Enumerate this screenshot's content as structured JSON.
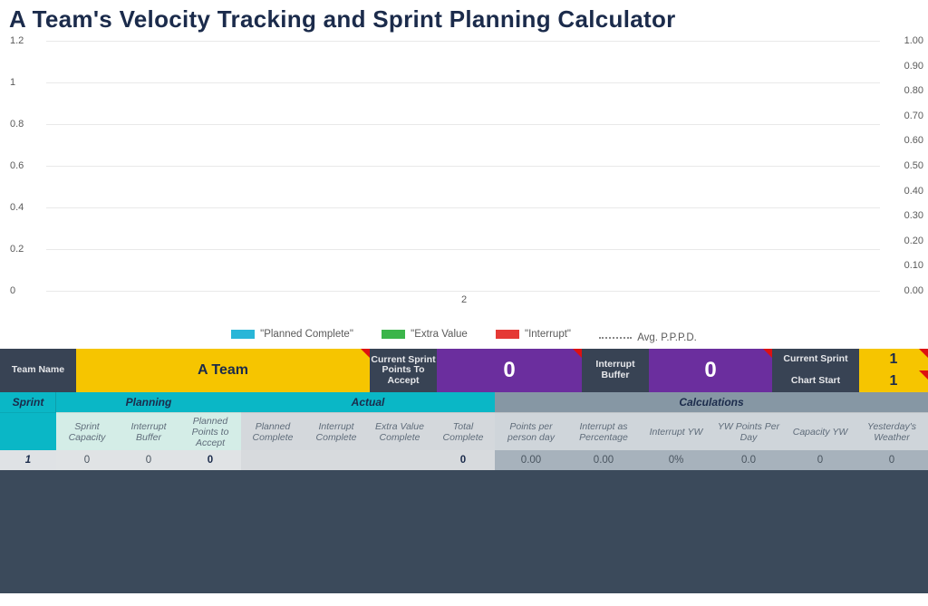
{
  "title": "A Team's  Velocity Tracking and Sprint Planning Calculator",
  "chart_data": {
    "type": "bar",
    "categories": [
      "2"
    ],
    "series": [
      {
        "name": "\"Planned Complete\"",
        "color": "#29b6d8",
        "values": [
          0
        ]
      },
      {
        "name": "\"Extra Value",
        "color": "#3bb54a",
        "values": [
          0
        ]
      },
      {
        "name": "\"Interrupt\"",
        "color": "#e53935",
        "values": [
          0
        ]
      },
      {
        "name": "Avg. P.P.P.D.",
        "style": "dotted",
        "values": [
          0
        ]
      }
    ],
    "y_left": {
      "ticks": [
        "0",
        "0.2",
        "0.4",
        "0.6",
        "0.8",
        "1",
        "1.2"
      ],
      "range": [
        0,
        1.2
      ]
    },
    "y_right": {
      "ticks": [
        "0.00",
        "0.10",
        "0.20",
        "0.30",
        "0.40",
        "0.50",
        "0.60",
        "0.70",
        "0.80",
        "0.90",
        "1.00"
      ],
      "range": [
        0,
        1.0
      ]
    }
  },
  "legend": {
    "planned_complete": "\"Planned Complete\"",
    "extra_value": "\"Extra Value",
    "interrupt": "\"Interrupt\"",
    "avg_ppd": "Avg. P.P.P.D."
  },
  "info": {
    "team_name_label": "Team Name",
    "team_name_value": "A Team",
    "csp_label": "Current Sprint Points To Accept",
    "csp_value": "0",
    "ibuf_label": "Interrupt Buffer",
    "ibuf_value": "0",
    "current_sprint_label": "Current Sprint",
    "current_sprint_value": "1",
    "chart_start_label": "Chart Start",
    "chart_start_value": "1"
  },
  "groups": {
    "sprint": "Sprint",
    "planning": "Planning",
    "actual": "Actual",
    "calculations": "Calculations"
  },
  "cols": {
    "sprint_capacity": "Sprint Capacity",
    "interrupt_buffer": "Interrupt Buffer",
    "planned_points_to_accept": "Planned Points to Accept",
    "planned_complete": "Planned Complete",
    "interrupt_complete": "Interrupt Complete",
    "extra_value_complete": "Extra Value Complete",
    "total_complete": "Total Complete",
    "points_per_person_day": "Points per person day",
    "interrupt_as_percentage": "Interrupt as Percentage",
    "interrupt_yw": "Interrupt YW",
    "yw_points_per_day": "YW Points Per Day",
    "capacity_yw": "Capacity YW",
    "yesterdays_weather": "Yesterday's Weather"
  },
  "row1": {
    "sprint": "1",
    "sprint_capacity": "0",
    "interrupt_buffer": "0",
    "planned_points_to_accept": "0",
    "planned_complete": "",
    "interrupt_complete": "",
    "extra_value_complete": "",
    "total_complete": "0",
    "points_per_person_day": "0.00",
    "interrupt_as_percentage": "0.00",
    "interrupt_yw": "0%",
    "yw_points_per_day": "0.0",
    "capacity_yw": "0",
    "yesterdays_weather": "0"
  }
}
